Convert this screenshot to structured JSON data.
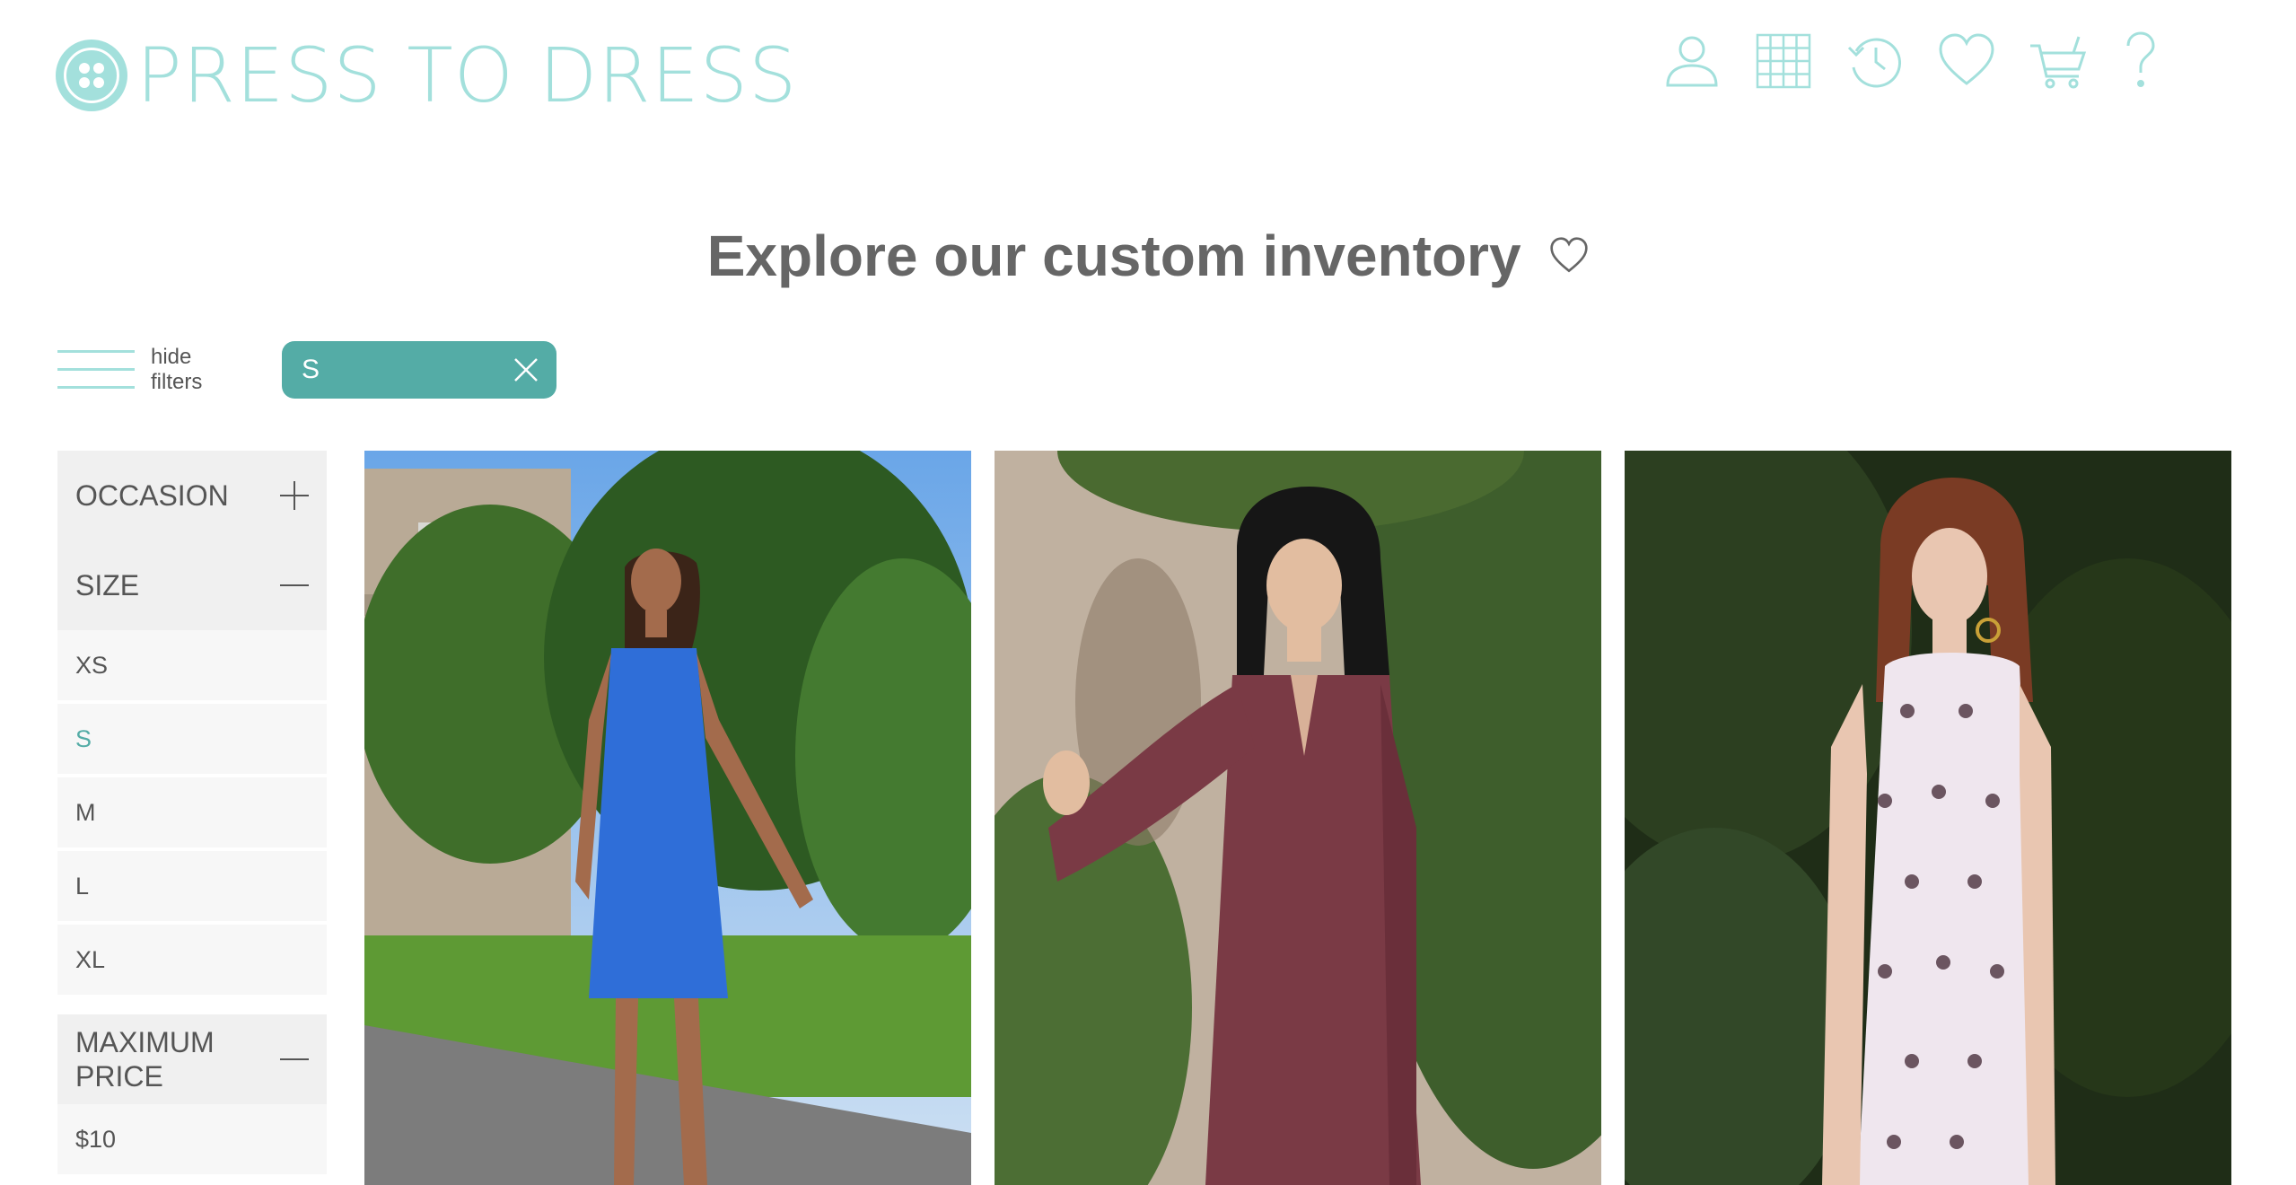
{
  "brand": {
    "name": "PRESS TO DRESS",
    "color": "#a3e0dc"
  },
  "nav": {
    "icons": [
      "user-icon",
      "grid-icon",
      "history-icon",
      "heart-icon",
      "cart-icon",
      "help-icon"
    ],
    "help_glyph": "?"
  },
  "headline": {
    "text": "Explore our custom inventory",
    "icon": "heart-icon"
  },
  "filters_toggle": {
    "line1": "hide",
    "line2": "filters"
  },
  "active_filter": {
    "label": "S",
    "color": "#54aca6"
  },
  "sidebar": {
    "occasion": {
      "label": "OCCASION",
      "expanded": false
    },
    "size": {
      "label": "SIZE",
      "expanded": true,
      "options": [
        "XS",
        "S",
        "M",
        "L",
        "XL"
      ],
      "selected": "S"
    },
    "max_price": {
      "label_line1": "MAXIMUM",
      "label_line2": "PRICE",
      "expanded": true,
      "options": [
        "$10"
      ]
    }
  },
  "products": [
    {
      "name": "blue-sleeveless-dress",
      "dress_color": "#2f6ed8"
    },
    {
      "name": "burgundy-lace-dress",
      "dress_color": "#7a3a45"
    },
    {
      "name": "white-embroidered-dress",
      "dress_color": "#efe6ee"
    }
  ]
}
